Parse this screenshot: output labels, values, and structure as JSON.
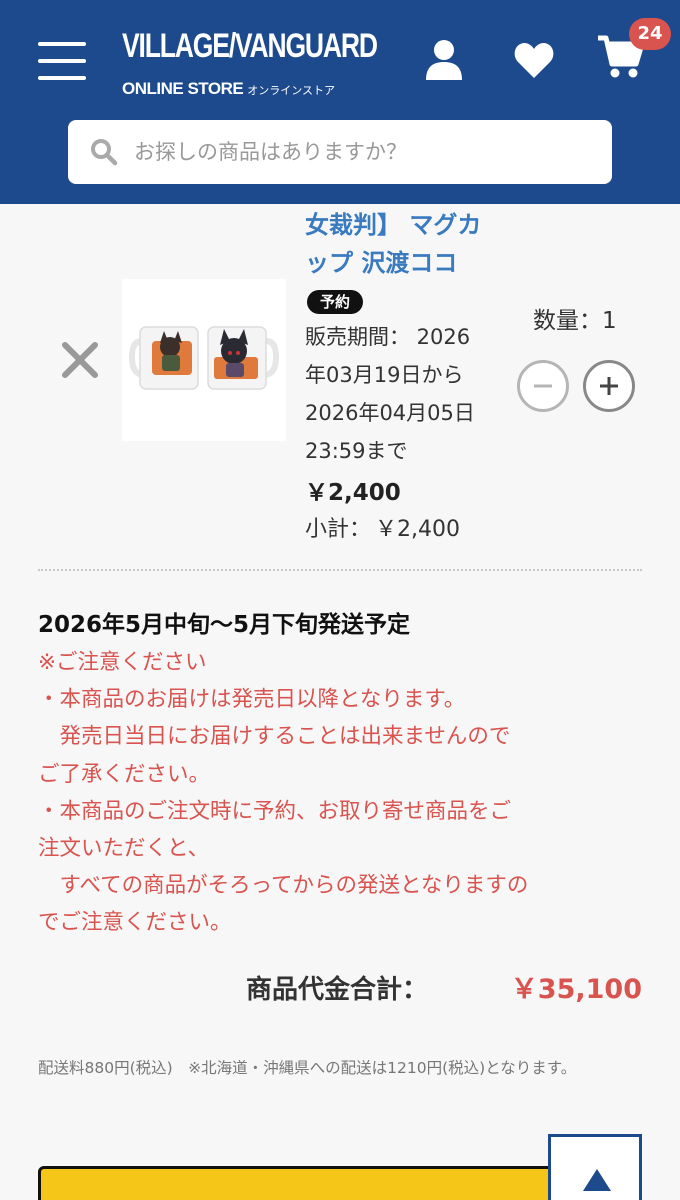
{
  "header": {
    "logo_main": "VILLAGE/VANGUARD",
    "logo_sub_en": "ONLINE STORE",
    "logo_sub_ja": "オンラインストア",
    "cart_count": "24",
    "brand_color": "#1c4a8c"
  },
  "search": {
    "placeholder": "お探しの商品はありますか？"
  },
  "cart_item": {
    "name_line1": "女裁判】 マグカ",
    "name_line2": "ップ 沢渡ココ",
    "badge": "予約",
    "period_lines": [
      "販売期間： 2026",
      "年03月19日から",
      "2026年04月05日",
      "23:59まで"
    ],
    "price": "￥2,400",
    "subtotal_label": "小計：",
    "subtotal_value": "￥2,400",
    "quantity_label": "数量：1"
  },
  "shipping": {
    "title": "2026年5月中旬〜5月下旬発送予定",
    "notice_lines": [
      "※ご注意ください",
      "・本商品のお届けは発売日以降となります。",
      "　発売日当日にお届けすることは出来ませんので",
      "ご了承ください。",
      "・本商品のご注文時に予約、お取り寄せ商品をご",
      "注文いただくと、",
      "　すべての商品がそろってからの発送となりますの",
      "でご注意ください。"
    ],
    "notice_color": "#d9534f"
  },
  "totals": {
    "label": "商品代金合計：",
    "value": "￥35,100"
  },
  "shipping_fee_note": "配送料880円(税込)　※北海道・沖縄県への配送は1210円(税込)となります。",
  "icons": {
    "menu": "hamburger-menu-icon",
    "user": "user-icon",
    "favorite": "heart-icon",
    "cart": "cart-icon",
    "search": "search-icon",
    "remove": "close-icon",
    "scroll_top": "arrow-up-icon"
  }
}
